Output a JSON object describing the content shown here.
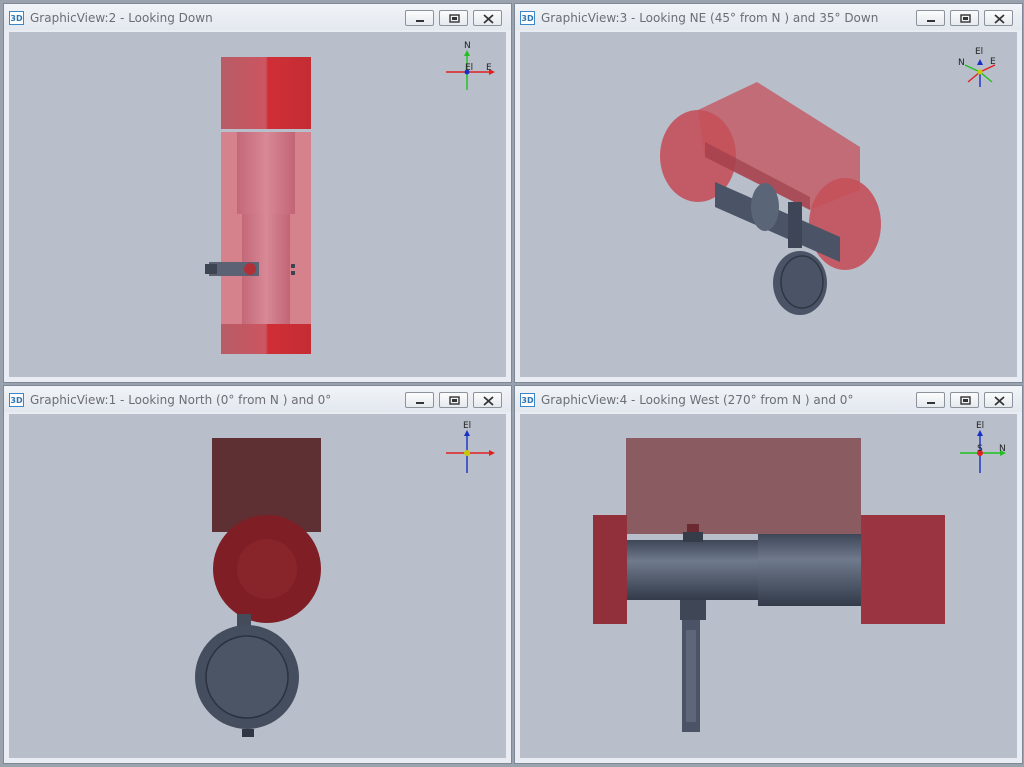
{
  "windows": [
    {
      "id": "gv2",
      "title": "GraphicView:2 - Looking Down",
      "axes": [
        "N",
        "El",
        "E"
      ]
    },
    {
      "id": "gv3",
      "title": "GraphicView:3 - Looking NE (45° from N ) and 35° Down",
      "axes": [
        "El",
        "N",
        "E"
      ]
    },
    {
      "id": "gv1",
      "title": "GraphicView:1 - Looking North (0° from N ) and 0°",
      "axes": [
        "El"
      ]
    },
    {
      "id": "gv4",
      "title": "GraphicView:4 - Looking West (270° from N ) and 0°",
      "axes": [
        "El",
        "S",
        "N"
      ]
    }
  ],
  "app_icon": "3D",
  "controls": {
    "minimize": "minimize-icon",
    "maximize": "maximize-icon",
    "close": "close-icon"
  },
  "colors": {
    "pipe_red": "#c8323c",
    "pipe_dark": "#4b5566",
    "viewport": "#b8bfca",
    "x_axis": "#e02020",
    "y_axis": "#20c020",
    "z_axis": "#1a2fc8"
  }
}
